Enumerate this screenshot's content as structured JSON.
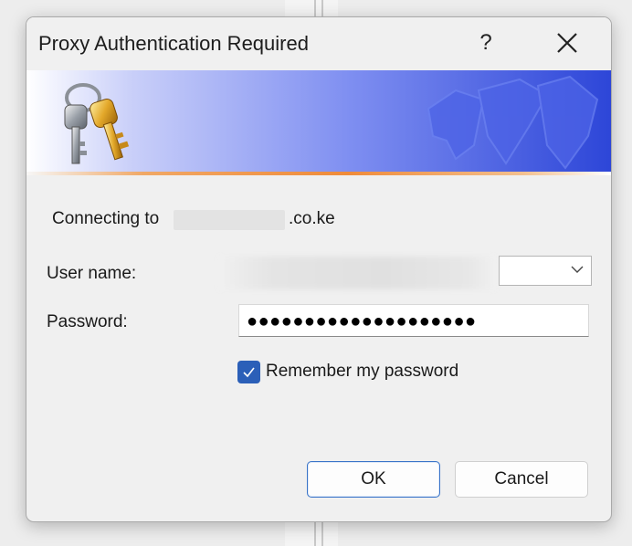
{
  "dialog": {
    "title": "Proxy Authentication Required",
    "help_label": "?",
    "connecting_label": "Connecting to",
    "connecting_domain": ".co.ke",
    "username_label": "User name:",
    "username_value": "",
    "password_label": "Password:",
    "password_value": "●●●●●●●●●●●●●●●●●●●●",
    "remember_label": "Remember my password",
    "remember_checked": true,
    "ok_label": "OK",
    "cancel_label": "Cancel"
  },
  "icons": {
    "banner": "keys-icon",
    "close": "close-icon",
    "dropdown": "chevron-down-icon",
    "check": "checkmark-icon"
  },
  "colors": {
    "accent": "#2b5fb8",
    "banner_end": "#2d46d8",
    "banner_line": "#ef8b3a"
  }
}
